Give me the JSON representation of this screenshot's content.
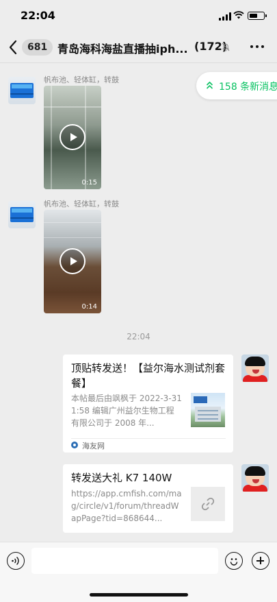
{
  "status_bar": {
    "time": "22:04",
    "battery_level": 0.6
  },
  "navbar": {
    "unread_count": "681",
    "title": "青岛海科海盐直播抽iph...",
    "member_count": "(172)"
  },
  "new_messages_pill": {
    "label": "158 条新消息"
  },
  "messages": [
    {
      "type": "video",
      "sender": "帆布池、轻体缸，转鼓",
      "duration": "0:15"
    },
    {
      "type": "video",
      "sender": "帆布池、轻体缸，转鼓",
      "duration": "0:14"
    }
  ],
  "timestamp": "22:04",
  "link_cards": [
    {
      "title": "顶贴转发送！【益尔海水测试剂套餐】",
      "description": "本帖最后由飒枫于 2022-3-311:58 编辑广州益尔生物工程有限公司于 2008 年...",
      "source": "海友网"
    },
    {
      "title": "转发送大礼 K7 140W",
      "description": "https://app.cmfish.com/mag/circle/v1/forum/threadWapPage?tid=868644..."
    }
  ],
  "input_bar": {
    "value": ""
  },
  "colors": {
    "accent": "#07c160",
    "background": "#ededed"
  }
}
